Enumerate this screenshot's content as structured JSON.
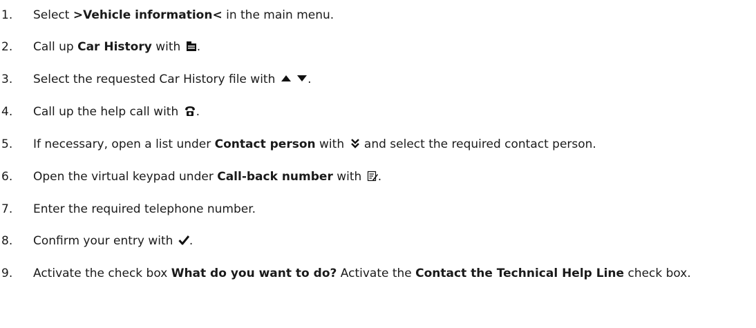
{
  "steps": [
    {
      "number": "1.",
      "parts": [
        {
          "t": "text",
          "v": "Select "
        },
        {
          "t": "bold",
          "v": ">Vehicle information<"
        },
        {
          "t": "text",
          "v": " in the main menu."
        }
      ]
    },
    {
      "number": "2.",
      "parts": [
        {
          "t": "text",
          "v": "Call up "
        },
        {
          "t": "bold",
          "v": "Car History"
        },
        {
          "t": "text",
          "v": " with "
        },
        {
          "t": "icon",
          "v": "folder-icon"
        },
        {
          "t": "text",
          "v": "."
        }
      ]
    },
    {
      "number": "3.",
      "parts": [
        {
          "t": "text",
          "v": "Select the requested Car History file with "
        },
        {
          "t": "icon",
          "v": "arrow-up-icon"
        },
        {
          "t": "text",
          "v": " "
        },
        {
          "t": "icon",
          "v": "arrow-down-icon"
        },
        {
          "t": "text",
          "v": "."
        }
      ]
    },
    {
      "number": "4.",
      "parts": [
        {
          "t": "text",
          "v": "Call up the help call with "
        },
        {
          "t": "icon",
          "v": "help-call-icon"
        },
        {
          "t": "text",
          "v": "."
        }
      ]
    },
    {
      "number": "5.",
      "parts": [
        {
          "t": "text",
          "v": "If necessary, open a list under "
        },
        {
          "t": "bold",
          "v": "Contact person"
        },
        {
          "t": "text",
          "v": " with "
        },
        {
          "t": "icon",
          "v": "double-chevron-down-icon"
        },
        {
          "t": "text",
          "v": " and select the required contact person."
        }
      ]
    },
    {
      "number": "6.",
      "parts": [
        {
          "t": "text",
          "v": "Open the virtual keypad under "
        },
        {
          "t": "bold",
          "v": "Call-back number"
        },
        {
          "t": "text",
          "v": " with "
        },
        {
          "t": "icon",
          "v": "edit-icon"
        },
        {
          "t": "text",
          "v": "."
        }
      ]
    },
    {
      "number": "7.",
      "parts": [
        {
          "t": "text",
          "v": "Enter the required telephone number."
        }
      ]
    },
    {
      "number": "8.",
      "parts": [
        {
          "t": "text",
          "v": "Confirm your entry with "
        },
        {
          "t": "icon",
          "v": "checkmark-icon"
        },
        {
          "t": "text",
          "v": "."
        }
      ]
    },
    {
      "number": "9.",
      "parts": [
        {
          "t": "text",
          "v": "Activate the check box "
        },
        {
          "t": "bold",
          "v": "What do you want to do?"
        },
        {
          "t": "text",
          "v": " Activate the "
        },
        {
          "t": "bold",
          "v": "Contact the Technical Help Line"
        },
        {
          "t": "text",
          "v": " check box."
        }
      ]
    }
  ]
}
